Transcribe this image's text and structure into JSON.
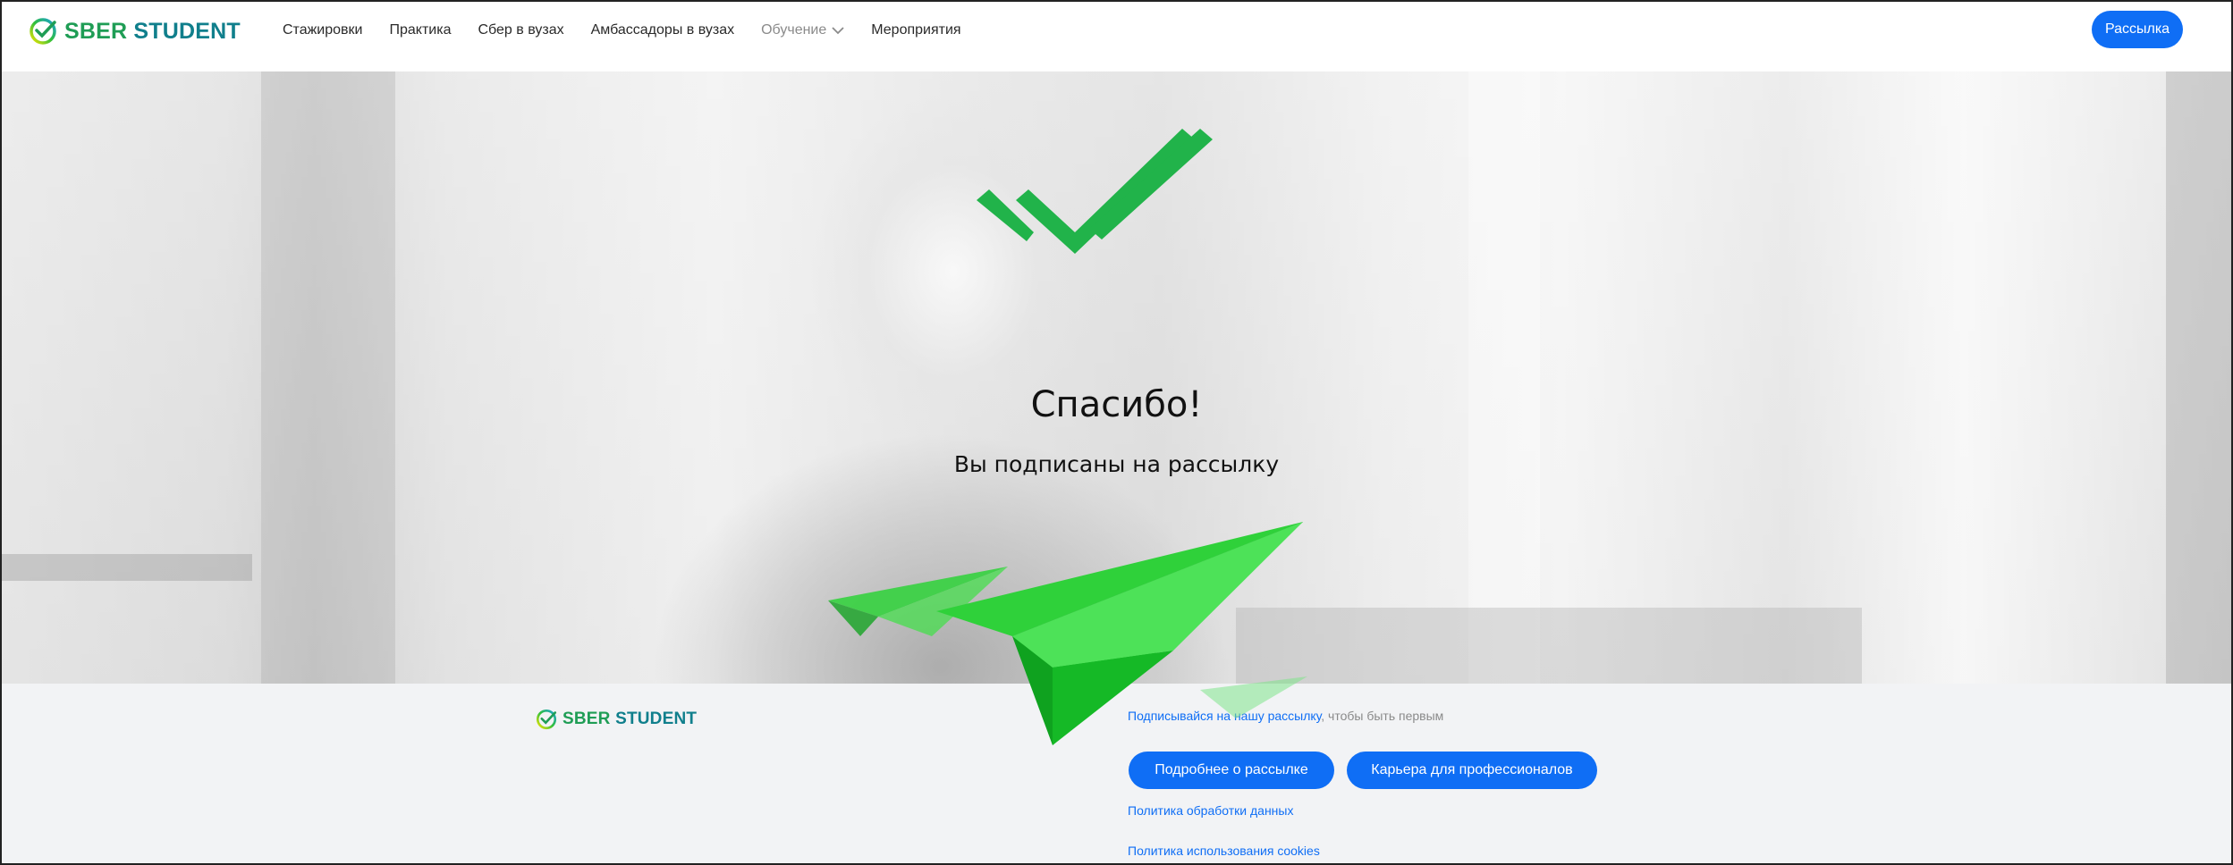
{
  "header": {
    "logo": {
      "brand": "SBER",
      "product": "STUDENT",
      "icon": "sber-check-logo-icon"
    },
    "nav": [
      {
        "label": "Стажировки"
      },
      {
        "label": "Практика"
      },
      {
        "label": "Сбер в вузах"
      },
      {
        "label": "Амбассадоры в вузах"
      },
      {
        "label": "Обучение",
        "has_dropdown": true,
        "icon": "chevron-down-icon"
      },
      {
        "label": "Мероприятия"
      }
    ],
    "subscribe_label": "Рассылка"
  },
  "hero": {
    "icon": "double-check-icon",
    "title": "Спасибо!",
    "subtitle": "Вы подписаны на рассылку",
    "decoration": "paper-plane-icon"
  },
  "footer": {
    "logo": {
      "brand": "SBER",
      "product": "STUDENT"
    },
    "note_link": "Подписывайся на нашу рассылку",
    "note_rest": ", чтобы быть первым",
    "buttons": [
      {
        "label": "Подробнее о рассылке"
      },
      {
        "label": "Карьера для профессионалов"
      }
    ],
    "links": [
      {
        "label": "Политика обработки данных"
      },
      {
        "label": "Политика использования cookies"
      }
    ]
  },
  "colors": {
    "brand_green": "#1f9d55",
    "brand_teal": "#107f8c",
    "accent_blue": "#0f6ef5",
    "check_green": "#21b34a",
    "plane_green": "#2ecc40",
    "footer_bg": "#f2f3f5"
  }
}
